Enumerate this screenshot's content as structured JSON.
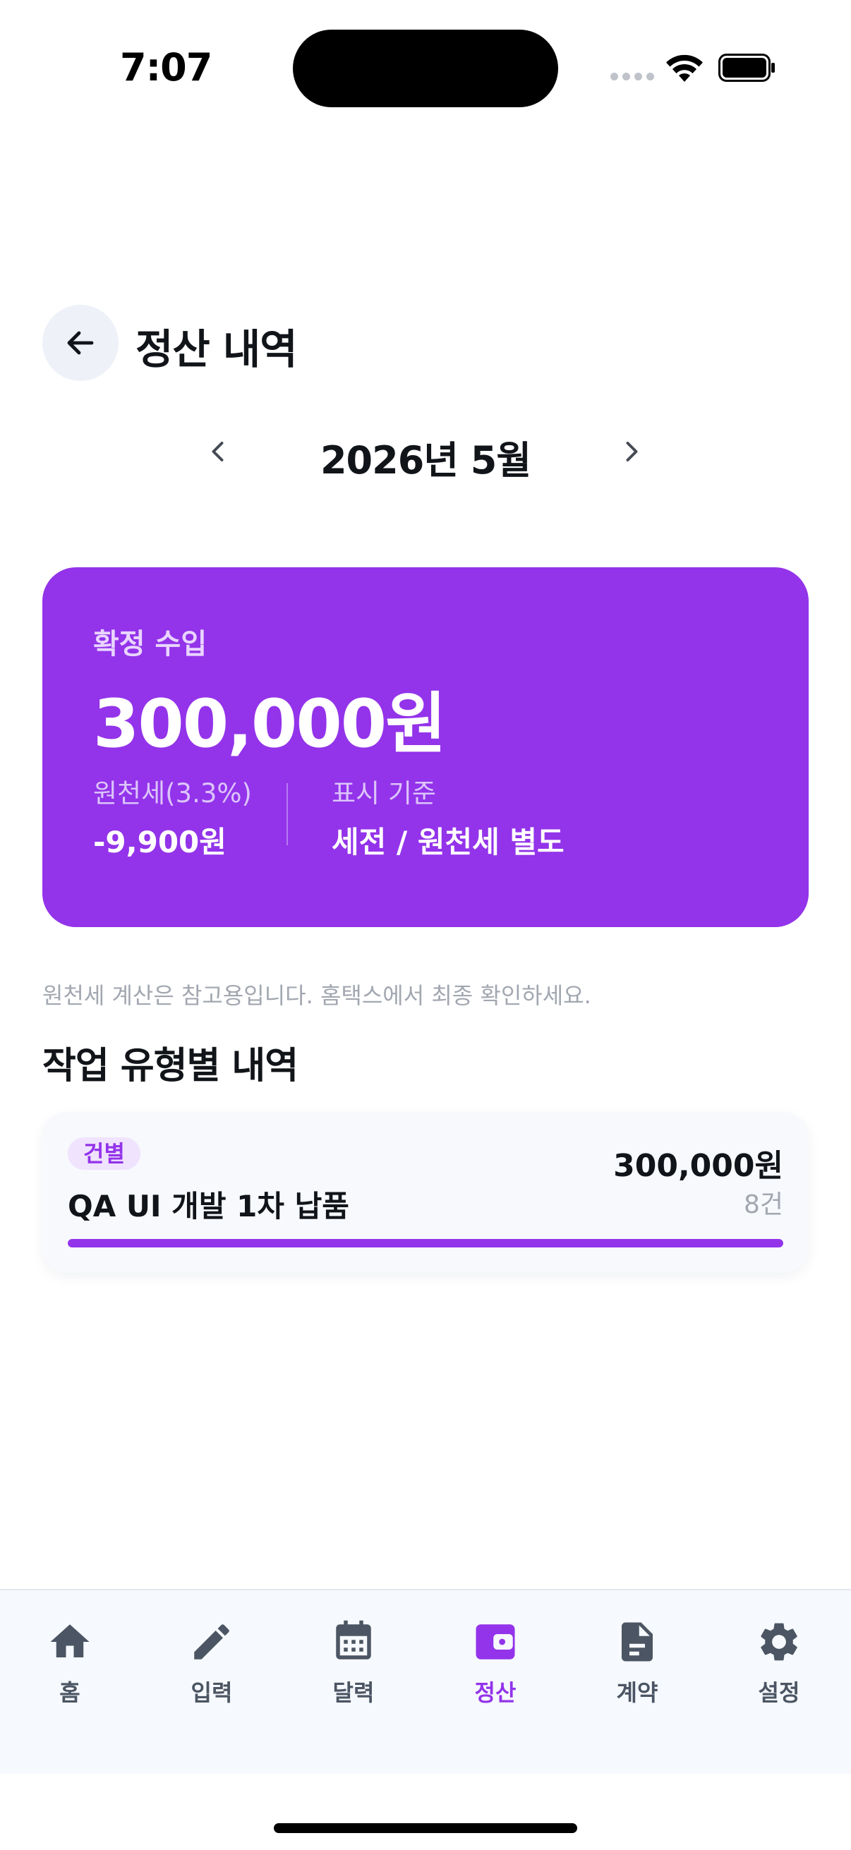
{
  "status_bar": {
    "time": "7:07"
  },
  "header": {
    "title": "정산 내역"
  },
  "month_selector": {
    "label": "2026년 5월"
  },
  "income_card": {
    "label": "확정 수입",
    "amount": "300,000원",
    "tax_label": "원천세(3.3%)",
    "tax_value": "-9,900원",
    "basis_label": "표시 기준",
    "basis_value": "세전 / 원천세 별도",
    "background_color": "#9333ea"
  },
  "tax_note": "원천세 계산은 참고용입니다. 홈택스에서 최종 확인하세요.",
  "work_section": {
    "title": "작업 유형별 내역",
    "items": [
      {
        "badge": "건별",
        "title": "QA UI 개발 1차 납품",
        "amount": "300,000원",
        "count": "8건",
        "progress": 1.0
      }
    ]
  },
  "bottom_nav": {
    "items": [
      {
        "label": "홈",
        "icon": "home-icon",
        "active": false
      },
      {
        "label": "입력",
        "icon": "pencil-icon",
        "active": false
      },
      {
        "label": "달력",
        "icon": "calendar-icon",
        "active": false
      },
      {
        "label": "정산",
        "icon": "wallet-icon",
        "active": true
      },
      {
        "label": "계약",
        "icon": "document-icon",
        "active": false
      },
      {
        "label": "설정",
        "icon": "gear-icon",
        "active": false
      }
    ]
  },
  "colors": {
    "accent": "#9333ea",
    "nav_inactive": "#4b5563"
  }
}
